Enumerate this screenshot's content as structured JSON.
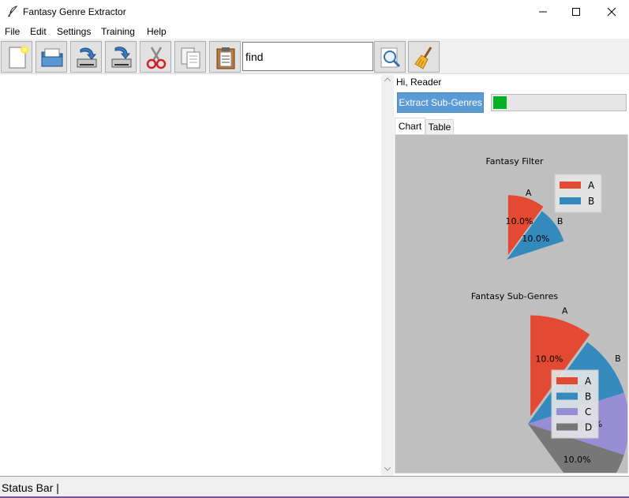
{
  "window": {
    "title": "Fantasy Genre Extractor"
  },
  "menu": [
    "File",
    "Edit",
    "Settings",
    "Training",
    "Help"
  ],
  "toolbar": {
    "buttons": [
      "new-file",
      "open-folder",
      "load",
      "save",
      "cut",
      "copy",
      "paste"
    ],
    "search_value": "find"
  },
  "right_panel": {
    "greeting": "Hi, Reader",
    "extract_label": "Extract Sub-Genres",
    "progress": 0.1,
    "tabs": [
      "Chart",
      "Table"
    ],
    "active_tab": "Chart"
  },
  "status": {
    "text": "Status Bar |"
  },
  "colors": {
    "A": "#e24a33",
    "B": "#348abd",
    "C": "#988ed5",
    "D": "#777777",
    "panel": "#bfbfbf",
    "accent": "#5b9bd5"
  },
  "chart_data": [
    {
      "type": "pie",
      "title": "Fantasy Filter",
      "categories": [
        "A",
        "B"
      ],
      "values": [
        10.0,
        10.0
      ],
      "value_labels": [
        "10.0%",
        "10.0%"
      ],
      "legend": [
        "A",
        "B"
      ],
      "legend_position": "top-right",
      "explode": "A"
    },
    {
      "type": "pie",
      "title": "Fantasy Sub-Genres",
      "categories": [
        "A",
        "B",
        "C",
        "D"
      ],
      "values": [
        10.0,
        10.0,
        10.0,
        10.0
      ],
      "value_labels": [
        "10.0%",
        "10.0%",
        "10.0%",
        "10.0%"
      ],
      "legend": [
        "A",
        "B",
        "C",
        "D"
      ],
      "legend_position": "lower-right",
      "explode": "A"
    }
  ]
}
